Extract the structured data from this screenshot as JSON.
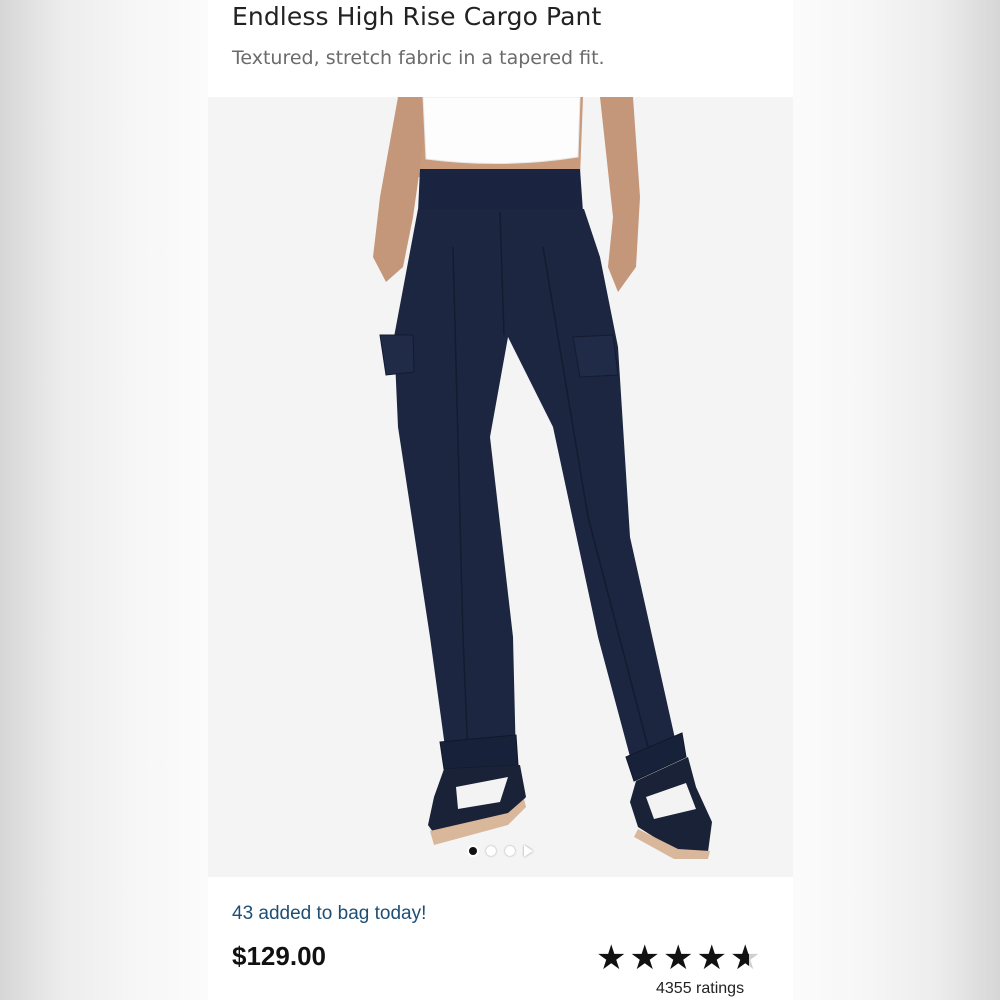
{
  "product": {
    "title": "Endless High Rise Cargo Pant",
    "subtitle": "Textured, stretch fabric in a tapered fit.",
    "image_alt": "Model wearing navy high rise cargo pants with white tank top and navy sneakers",
    "pant_color": "#1c2640",
    "gallery": {
      "image_count": 3,
      "active_index": 0,
      "next_icon": "chevron-right-icon"
    }
  },
  "purchase": {
    "added_today": "43 added to bag today!",
    "price": "$129.00"
  },
  "rating": {
    "stars": 4.6,
    "star_icon": "star-icon",
    "count_text": "4355 ratings"
  },
  "colors": {
    "added_text": "#1f4e74",
    "title_text": "#222222",
    "subtitle_text": "#6b6b6b"
  }
}
